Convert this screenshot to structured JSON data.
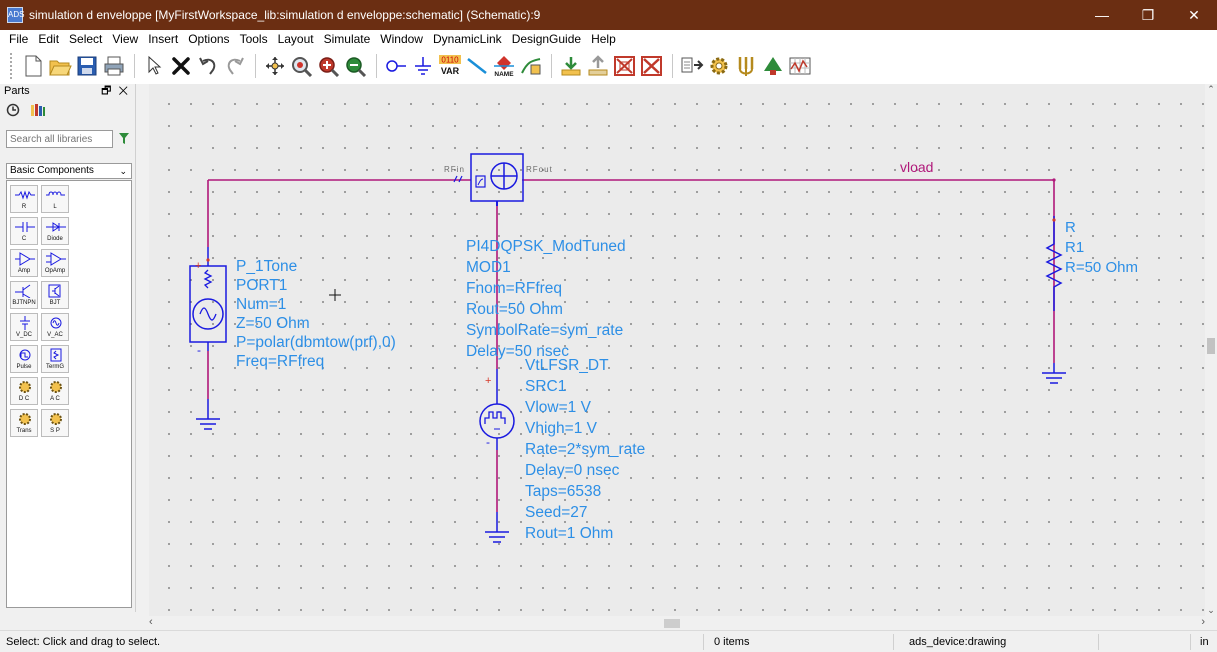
{
  "window": {
    "title": "simulation d enveloppe [MyFirstWorkspace_lib:simulation d enveloppe:schematic] (Schematic):9",
    "app_icon_text": "ADS",
    "minimize": "—",
    "maximize": "❐",
    "close": "✕"
  },
  "menu": [
    "File",
    "Edit",
    "Select",
    "View",
    "Insert",
    "Options",
    "Tools",
    "Layout",
    "Simulate",
    "Window",
    "DynamicLink",
    "DesignGuide",
    "Help"
  ],
  "toolbar": {
    "var_label": "VAR",
    "var_bits": "0110",
    "name_label": "NAME"
  },
  "parts": {
    "title": "Parts",
    "controls": "🗗 ✕",
    "search_placeholder": "Search all libraries",
    "library": "Basic Components",
    "items": [
      {
        "label": "R"
      },
      {
        "label": "L"
      },
      {
        "label": "C"
      },
      {
        "label": "Diode"
      },
      {
        "label": "Amp"
      },
      {
        "label": "OpAmp"
      },
      {
        "label": "BJTNPN"
      },
      {
        "label": "BJT"
      },
      {
        "label": "V_DC"
      },
      {
        "label": "V_AC"
      },
      {
        "label": "Pulse"
      },
      {
        "label": "TermG"
      },
      {
        "label": "D C"
      },
      {
        "label": "A C"
      },
      {
        "label": "Trans"
      },
      {
        "label": "S P"
      }
    ]
  },
  "schematic": {
    "port": {
      "lines": [
        "P_1Tone",
        "PORT1",
        "Num=1",
        "Z=50 Ohm",
        "P=polar(dbmtow(prf),0)",
        "Freq=RFfreq"
      ]
    },
    "modulator": {
      "pin_in": "RFin",
      "pin_out": "RFout",
      "lines": [
        "PI4DQPSK_ModTuned",
        "MOD1",
        "Fnom=RFfreq",
        "Rout=50 Ohm",
        "SymbolRate=sym_rate",
        "Delay=50 nsec"
      ]
    },
    "source": {
      "lines": [
        "VtLFSR_DT",
        "SRC1",
        "Vlow=1 V",
        "Vhigh=1 V",
        "Rate=2*sym_rate",
        "Delay=0 nsec",
        "Taps=6538",
        "Seed=27",
        "Rout=1 Ohm"
      ]
    },
    "resistor": {
      "lines": [
        "R",
        "R1",
        "R=50 Ohm"
      ]
    },
    "wire_label": "vload",
    "colors": {
      "wire": "#b0187a",
      "component": "#1a1ae0",
      "label": "#2d8fe6"
    }
  },
  "status": {
    "hint": "Select: Click and drag to select.",
    "items": "0 items",
    "context": "ads_device:drawing",
    "units": "in"
  }
}
